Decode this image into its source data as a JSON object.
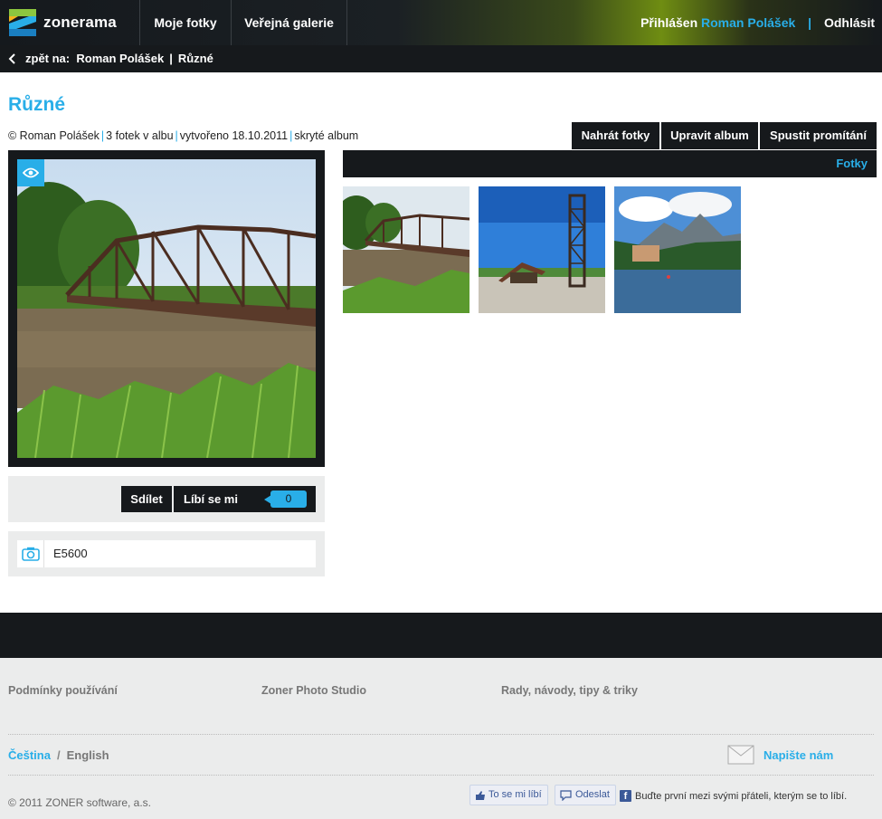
{
  "header": {
    "logo_text": "zonerama",
    "nav": [
      "Moje fotky",
      "Veřejná galerie"
    ],
    "login_prefix": "Přihlášen",
    "user_name": "Roman Polášek",
    "logout": "Odhlásit"
  },
  "breadcrumb": {
    "prefix": "zpět na:",
    "items": [
      "Roman Polášek",
      "Různé"
    ]
  },
  "album": {
    "title": "Různé",
    "owner": "© Roman Polášek",
    "count": "3 fotek v albu",
    "created": "vytvořeno 18.10.2011",
    "visibility": "skryté album"
  },
  "actions": [
    "Nahrát fotky",
    "Upravit album",
    "Spustit promítání"
  ],
  "share": {
    "share_label": "Sdílet",
    "like_label": "Líbí se mi",
    "like_count": "0"
  },
  "camera": {
    "model": "E5600"
  },
  "photos": {
    "header": "Fotky"
  },
  "footer": {
    "links": [
      "Podmínky používání",
      "Zoner Photo Studio",
      "Rady, návody, tipy & triky"
    ],
    "lang_cz": "Čeština",
    "lang_sep": "/",
    "lang_en": "English",
    "contact": "Napište nám",
    "copyright": "© 2011 ZONER software, a.s.",
    "fb_like": "To se mi líbí",
    "fb_send": "Odeslat",
    "fb_text": "Buďte první mezi svými přáteli, kterým se to líbí."
  },
  "colors": {
    "accent": "#29aee8",
    "dark": "#16191c",
    "light_panel": "#ebecec"
  }
}
